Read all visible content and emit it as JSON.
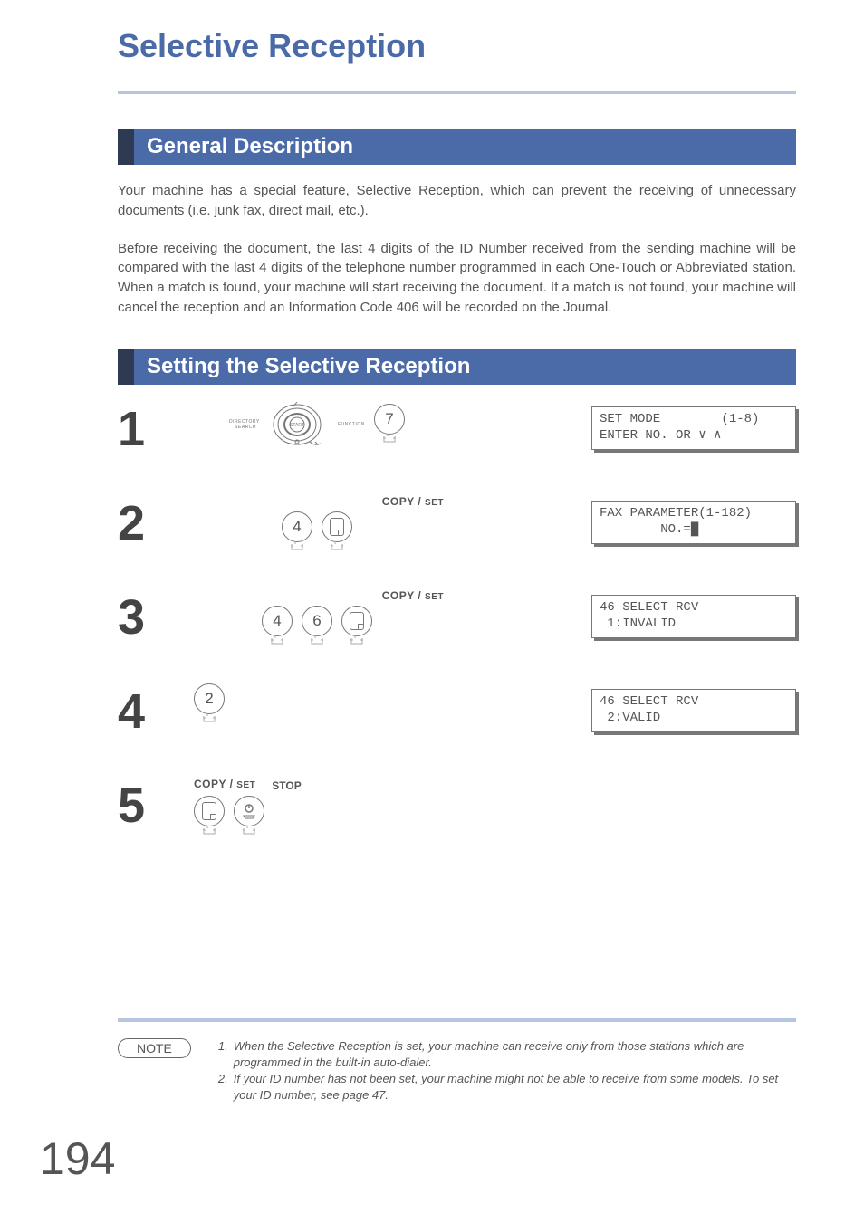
{
  "page": {
    "title": "Selective Reception",
    "number": "194"
  },
  "sections": {
    "general": {
      "heading": "General Description",
      "p1": "Your machine has a special feature, Selective Reception, which can prevent the receiving of unnecessary documents (i.e. junk fax, direct mail, etc.).",
      "p2": "Before receiving the document, the last 4 digits of the ID Number received from the sending machine will be compared with the last 4 digits of the telephone number programmed in each One-Touch or Abbreviated station. When a match is found, your machine will start receiving the document. If a match is not found, your machine will cancel the reception and an Information Code 406 will be recorded on the Journal."
    },
    "setting": {
      "heading": "Setting the Selective Reception",
      "step1": {
        "num": "1",
        "key": "7",
        "dial_left": "DIRECTORY SEARCH",
        "dial_center": "START",
        "dial_right": "FUNCTION",
        "lcd": "SET MODE        (1-8)\nENTER NO. OR ∨ ∧"
      },
      "step2": {
        "num": "2",
        "copyset_a": "COPY / ",
        "copyset_b": "SET",
        "key": "4",
        "lcd": "FAX PARAMETER(1-182)\n        NO.=█"
      },
      "step3": {
        "num": "3",
        "copyset_a": "COPY / ",
        "copyset_b": "SET",
        "keyA": "4",
        "keyB": "6",
        "lcd": "46 SELECT RCV\n 1:INVALID"
      },
      "step4": {
        "num": "4",
        "key": "2",
        "lcd": "46 SELECT RCV\n 2:VALID"
      },
      "step5": {
        "num": "5",
        "copyset_a": "COPY / ",
        "copyset_b": "SET",
        "stop": "STOP"
      }
    }
  },
  "note": {
    "label": "NOTE",
    "n1_num": "1.",
    "n1": "When the Selective Reception is set, your machine can receive only from those stations which are programmed in the built-in auto-dialer.",
    "n2_num": "2.",
    "n2": "If your ID number has not been set, your machine might not be able to receive from some models.  To set your ID number, see page 47."
  }
}
